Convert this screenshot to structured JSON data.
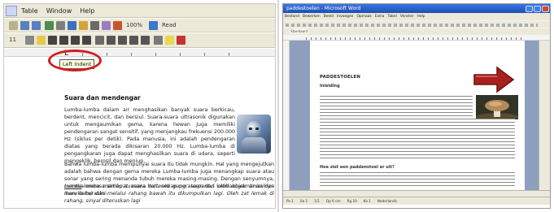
{
  "left_window": {
    "menu": [
      "Table",
      "Window",
      "Help"
    ],
    "toolbar": {
      "zoom": "100%",
      "read_label": "Read",
      "font_size": "11"
    },
    "ruler_tab_symbol": "L",
    "tooltip": "Left Indent",
    "document": {
      "title": "Suara dan mendengar",
      "paragraph1": "Lumba-lumba dalam air menghasikan banyak suara berkicau, berdent, mencicit, dan bersiul. Suara-suara ultrasonik digunakan untuk mengaumikan gema, karena hewan juga memiliki pendengaran sangat sensitif, yang menjangkau frekuensi 200.000 Hz (siklus per detik). Pada manusia, ini adalah pendengaran diatas yang berada dikisaran 20.000 Hz. Lumba-lumba di pengangkaran juga dapat menghasilkan suara di udara, seperti mengeklik, berosil dan meniup.",
      "paragraph2": "Bahwa lumba-lumba mempunyai suara itu tidak mungkin. Hal yang mengejutkan adalah bahwa dengan gema mereka Lumba-lumba juga menangkap suara atau sonar yang sering menanda tubuh mereka masing-masing. Dengan senyumnya, mereka merasa setiap suasana hati, setiap perasaan dan ketidaknyamanan dan mereka berasksi",
      "paragraph3_start": "Lumba",
      "paragraph3_rest": "-lumba membuat suara tertentu yang, terpantul oleh objek (misalnya ikan, batu) dan melalui rahang bawah itu dikumpulkan lagi. Oleh zat lemak di rahang, sinyal diteruskan lagi"
    }
  },
  "right_window": {
    "title": "paddestoelen - Microsoft Word",
    "menu": [
      "Bestand",
      "Bewerken",
      "Beeld",
      "Invoegen",
      "Opmaak",
      "Extra",
      "Tabel",
      "Venster",
      "Help"
    ],
    "style_box": "Standaard",
    "document": {
      "title": "PADDESTOELEN",
      "subtitle": "Inleiding",
      "heading2": "Hoe ziet een paddenstoel er uit?"
    },
    "status": [
      "Pa 1",
      "Se 1",
      "1/1",
      "Op 6 cm",
      "Rg 10",
      "Ko 1",
      "Nederlands"
    ]
  },
  "colors": {
    "highlight_oval": "#d21e1e",
    "arrow": "#a8201f",
    "title_bar": "#1c4fb8"
  }
}
